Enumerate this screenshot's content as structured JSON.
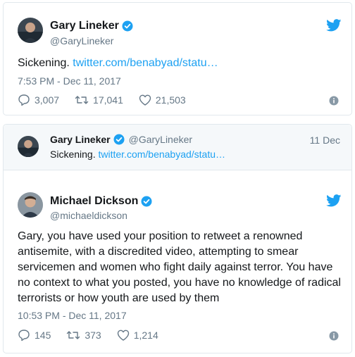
{
  "tweet1": {
    "name": "Gary Lineker",
    "handle": "@GaryLineker",
    "text": "Sickening.",
    "link": "twitter.com/benabyad/statu…",
    "timestamp": "7:53 PM - Dec 11, 2017",
    "replies": "3,007",
    "retweets": "17,041",
    "likes": "21,503"
  },
  "tweet2": {
    "quoted": {
      "name": "Gary Lineker",
      "handle": "@GaryLineker",
      "date": "11 Dec",
      "text": "Sickening.",
      "link": "twitter.com/benabyad/statu…"
    },
    "name": "Michael Dickson",
    "handle": "@michaeldickson",
    "text": "Gary, you have used your position to retweet a renowned antisemite, with a discredited video, attempting to smear servicemen and women who fight daily against terror. You have no context to what you posted, you have no knowledge of radical terrorists or how youth are used by them",
    "timestamp": "10:53 PM - Dec 11, 2017",
    "replies": "145",
    "retweets": "373",
    "likes": "1,214"
  },
  "colors": {
    "link": "#1da1f2",
    "verified": "#1da1f2",
    "muted": "#657786",
    "border": "#e1e8ed",
    "quote_bg": "#f5f8fa"
  },
  "icons": [
    "verified-badge-icon",
    "twitter-bird-icon",
    "reply-icon",
    "retweet-icon",
    "like-icon",
    "info-icon"
  ]
}
